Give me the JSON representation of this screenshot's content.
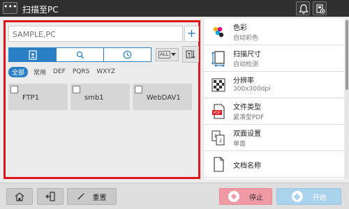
{
  "header": {
    "menu_label": "•••",
    "title": "扫描至PC",
    "icons": [
      "bell-icon",
      "tool-icon"
    ]
  },
  "search": {
    "placeholder": "SAMPLE,PC",
    "add_label": "+"
  },
  "tabs": {
    "icons": [
      "address-book-icon",
      "search-icon",
      "history-icon"
    ],
    "active": "address-book"
  },
  "filter": {
    "value": "ALL"
  },
  "index": {
    "items": [
      "全部",
      "常用",
      "DEF",
      "PQRS",
      "WXYZ"
    ],
    "active": "全部"
  },
  "destinations": [
    {
      "label": "FTP1",
      "checked": false
    },
    {
      "label": "smb1",
      "checked": false
    },
    {
      "label": "WebDAV1",
      "checked": false
    }
  ],
  "settings": [
    {
      "title": "色彩",
      "value": "自动彩色",
      "icon": "color-icon"
    },
    {
      "title": "扫描尺寸",
      "value": "自动检测",
      "icon": "scan-size-icon"
    },
    {
      "title": "分辨率",
      "value": "300x300dpi",
      "icon": "resolution-icon"
    },
    {
      "title": "文件类型",
      "value": "紧凑型PDF",
      "icon": "pdf-file-icon"
    },
    {
      "title": "双面设置",
      "value": "单面",
      "icon": "duplex-icon"
    },
    {
      "title": "文档名称",
      "value": "",
      "icon": "document-icon"
    }
  ],
  "settings_scroll_position": 0.0,
  "bottom": {
    "reset_label": "重置",
    "stop_label": "停止",
    "start_label": "开始",
    "stop_color": "#ef9aa5",
    "start_color": "#a9d3ec"
  },
  "colors": {
    "accent": "#2b7fc4",
    "highlight_border": "#e0141b"
  }
}
